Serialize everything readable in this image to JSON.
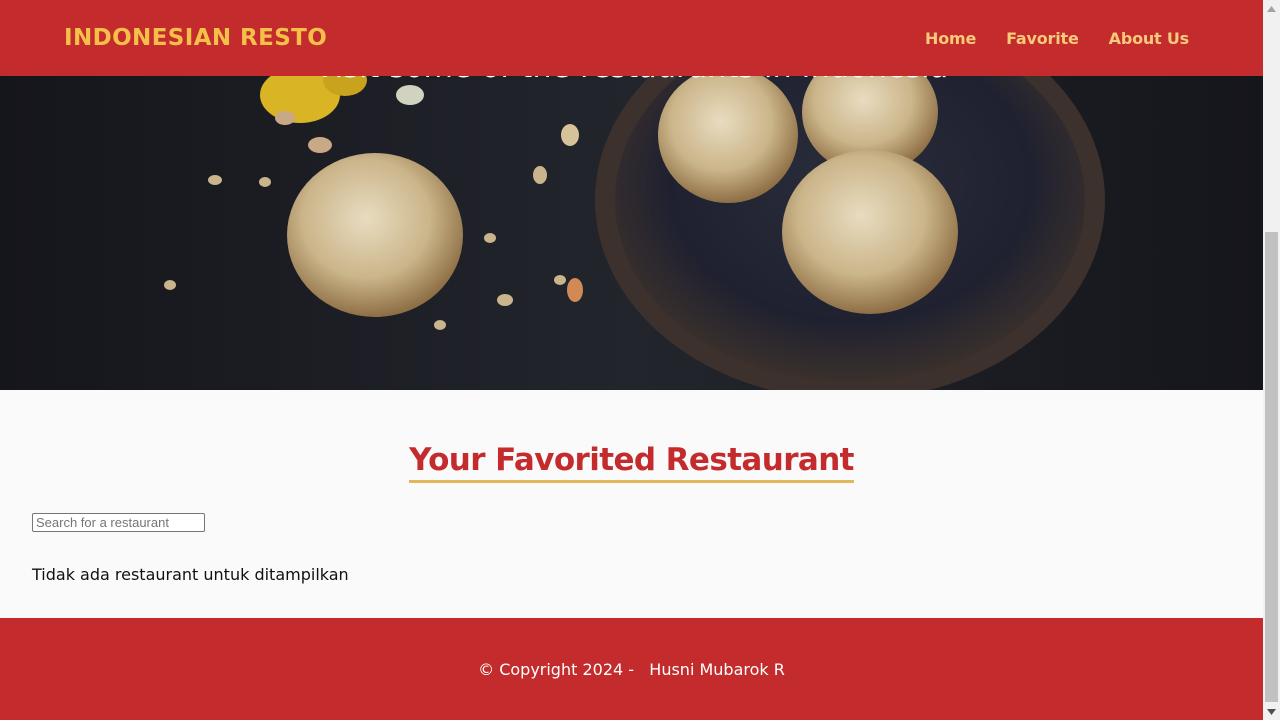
{
  "header": {
    "brand": "INDONESIAN RESTO",
    "nav": [
      {
        "label": "Home"
      },
      {
        "label": "Favorite"
      },
      {
        "label": "About Us"
      }
    ]
  },
  "hero": {
    "tagline": "Visit some of the restaurants in Indonesia"
  },
  "main": {
    "title": "Your Favorited Restaurant",
    "search": {
      "placeholder": "Search for a restaurant",
      "value": ""
    },
    "empty_message": "Tidak ada restaurant untuk ditampilkan"
  },
  "footer": {
    "text": "© Copyright 2024 -   Husni Mubarok R"
  },
  "colors": {
    "primary": "#c42b2d",
    "brand_text": "#f5c04a",
    "accent_underline": "#e2b75a"
  }
}
